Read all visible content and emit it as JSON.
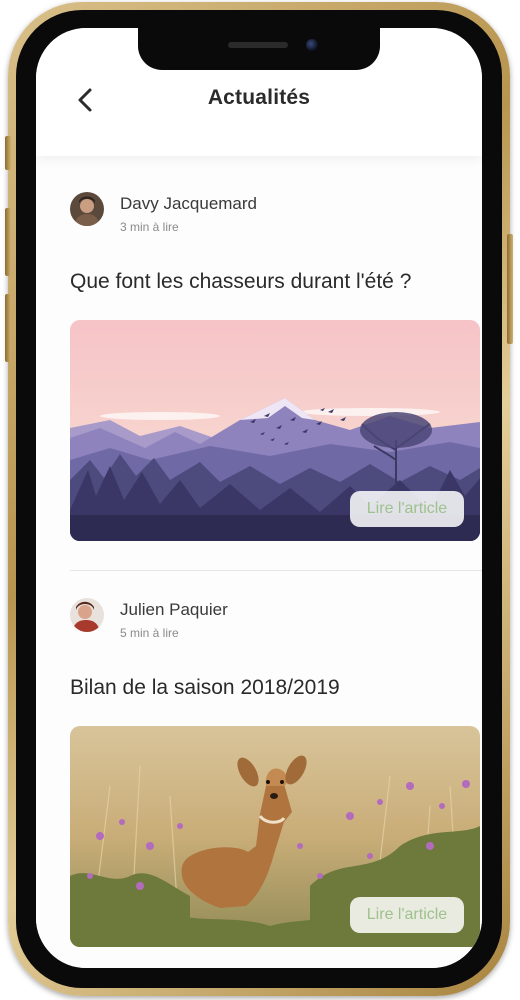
{
  "header": {
    "title": "Actualités"
  },
  "articles": [
    {
      "author": "Davy Jacquemard",
      "read_time": "3 min à lire",
      "title": "Que font les chasseurs durant l'été ?",
      "cta_label": "Lire l'article"
    },
    {
      "author": "Julien Paquier",
      "read_time": "5 min à lire",
      "title": "Bilan de la saison 2018/2019",
      "cta_label": "Lire l'article"
    }
  ],
  "icons": {
    "back": "chevron-left-icon"
  },
  "colors": {
    "device_frame": "#c9a862",
    "cta_text": "#9fc28d",
    "title_text": "#2b2b2b"
  }
}
